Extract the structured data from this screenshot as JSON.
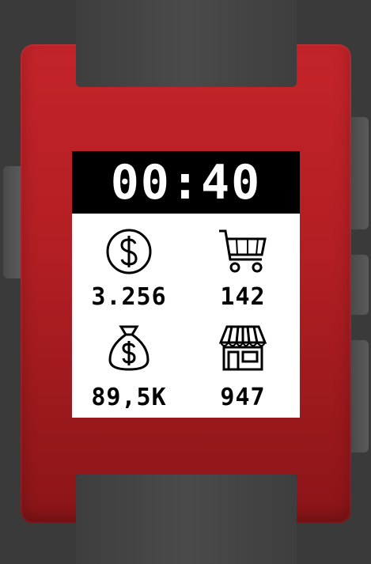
{
  "watch": {
    "time": "00:40",
    "colors": {
      "case": "#b11e23",
      "strap": "#444444",
      "screen_bg": "#ffffff",
      "clock_bg": "#000000"
    }
  },
  "stats": [
    {
      "icon": "dollar-coin-icon",
      "value": "3.256"
    },
    {
      "icon": "shopping-cart-icon",
      "value": "142"
    },
    {
      "icon": "money-bag-icon",
      "value": "89,5K"
    },
    {
      "icon": "storefront-icon",
      "value": "947"
    }
  ]
}
